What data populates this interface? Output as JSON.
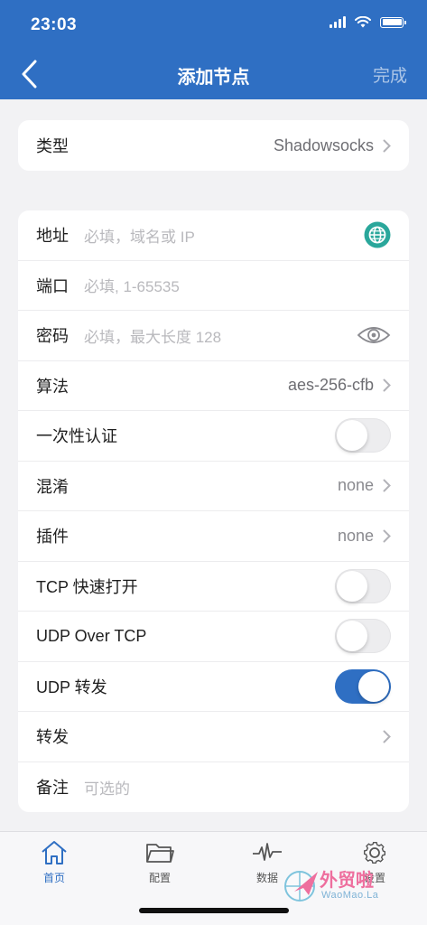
{
  "status_bar": {
    "time": "23:03"
  },
  "nav": {
    "title": "添加节点",
    "done_label": "完成"
  },
  "type_card": {
    "label": "类型",
    "value": "Shadowsocks"
  },
  "form": {
    "address": {
      "label": "地址",
      "placeholder": "必填，域名或 IP"
    },
    "port": {
      "label": "端口",
      "placeholder": "必填, 1-65535"
    },
    "password": {
      "label": "密码",
      "placeholder": "必填，最大长度 128"
    },
    "cipher": {
      "label": "算法",
      "value": "aes-256-cfb"
    },
    "one_time_auth": {
      "label": "一次性认证",
      "on": false
    },
    "obfs": {
      "label": "混淆",
      "value": "none"
    },
    "plugin": {
      "label": "插件",
      "value": "none"
    },
    "tcp_fast_open": {
      "label": "TCP 快速打开",
      "on": false
    },
    "udp_over_tcp": {
      "label": "UDP Over TCP",
      "on": false
    },
    "udp_relay": {
      "label": "UDP 转发",
      "on": true
    },
    "forward": {
      "label": "转发"
    },
    "note": {
      "label": "备注",
      "placeholder": "可选的"
    }
  },
  "tabbar": {
    "tabs": [
      {
        "label": "首页",
        "icon": "home-icon",
        "active": true
      },
      {
        "label": "配置",
        "icon": "folder-icon",
        "active": false
      },
      {
        "label": "数据",
        "icon": "activity-icon",
        "active": false
      },
      {
        "label": "设置",
        "icon": "gear-icon",
        "active": false
      }
    ]
  },
  "watermark": {
    "text": "外贸啦",
    "sub": "WaoMao.La"
  },
  "colors": {
    "accent": "#2f6fc3",
    "globe": "#2aa79b",
    "watermark": "#ee6f9e"
  }
}
